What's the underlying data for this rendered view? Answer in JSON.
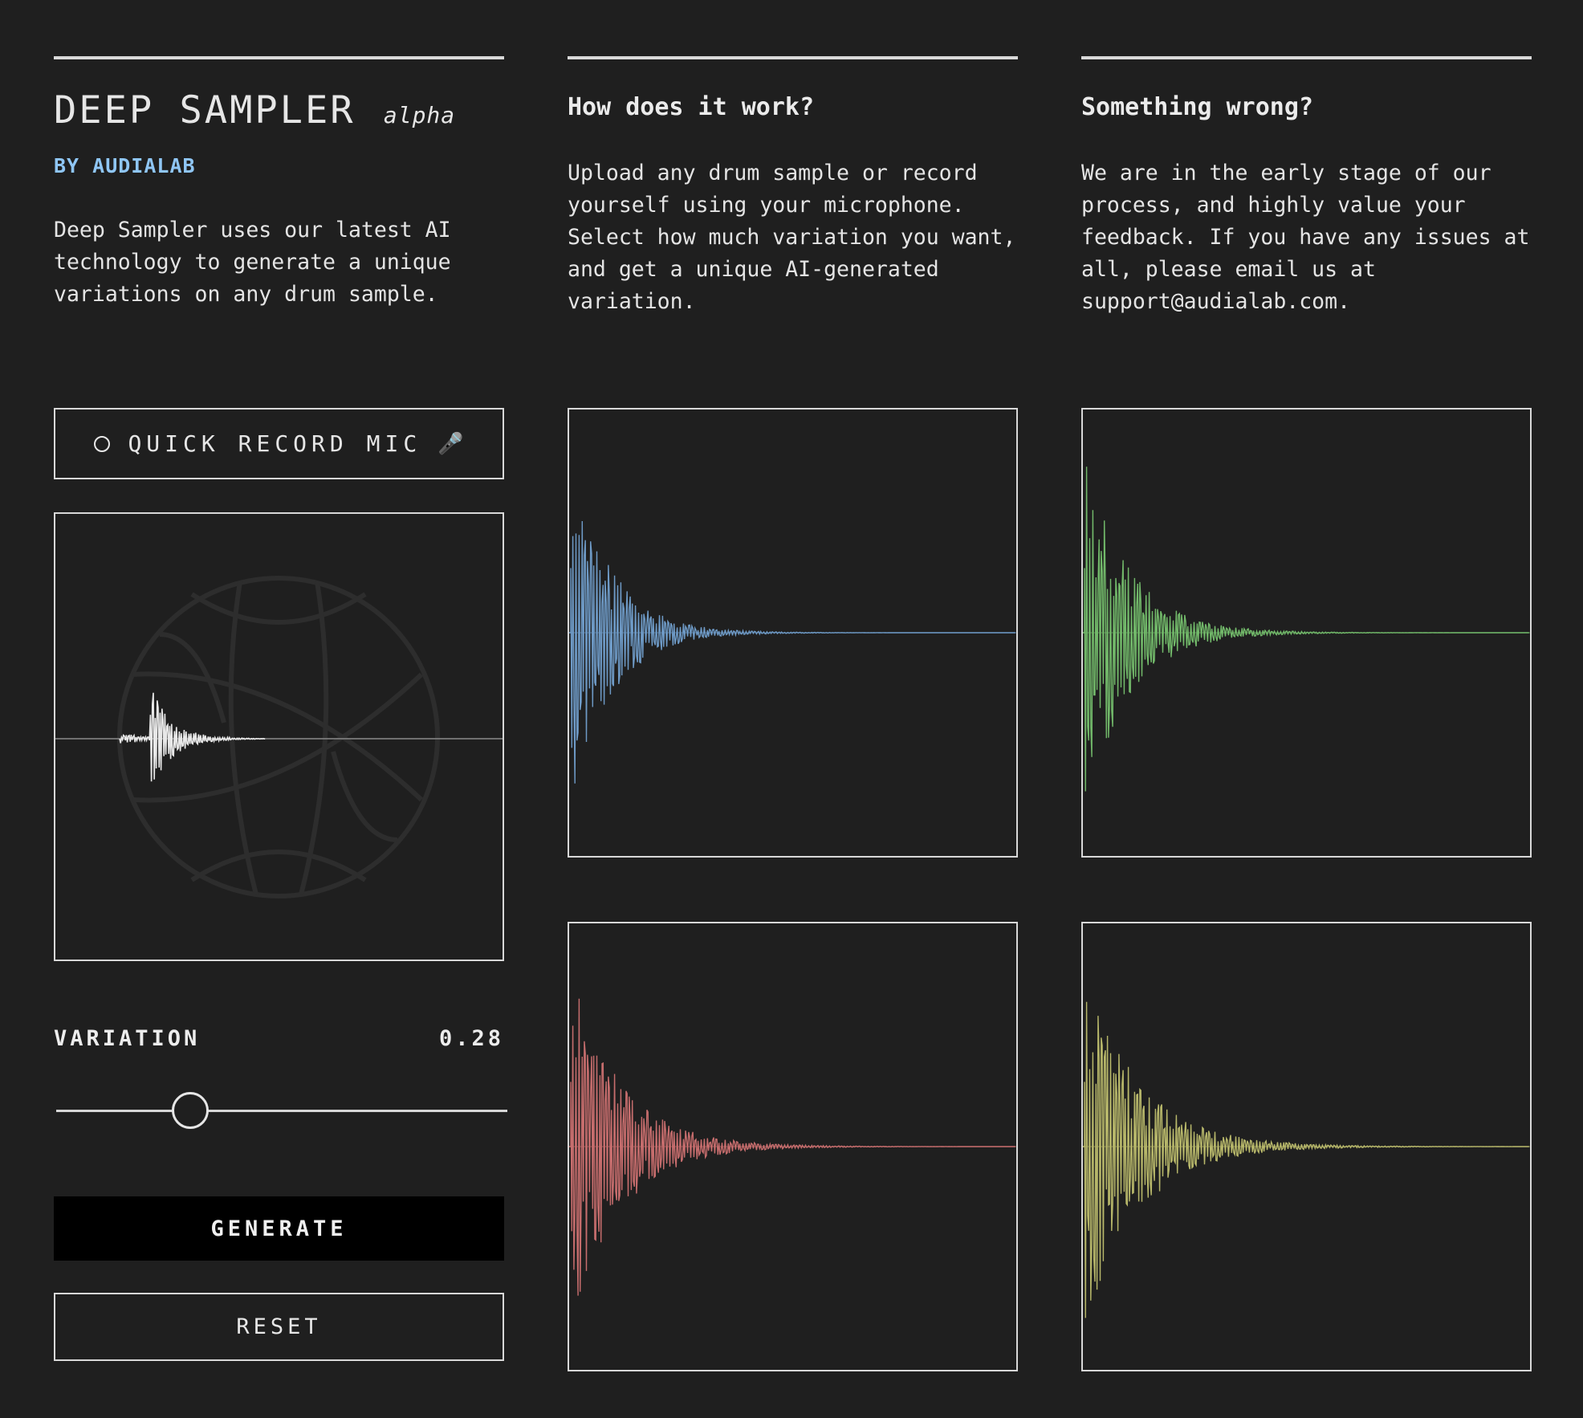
{
  "app": {
    "title": "DEEP SAMPLER",
    "title_suffix": "alpha",
    "byline": "BY AUDIALAB",
    "description": "Deep Sampler uses our latest AI technology to generate a unique variations on any drum sample."
  },
  "how_it_works": {
    "heading": "How does it work?",
    "body": "Upload any drum sample or record yourself using your microphone. Select how much variation you want, and get a unique AI-generated variation."
  },
  "something_wrong": {
    "heading": "Something wrong?",
    "body": "We are in the early stage of our process, and highly value your feedback. If you have any issues at all, please email us at support@audialab.com."
  },
  "controls": {
    "record_label": "QUICK RECORD MIC",
    "record_icon": "mic-icon",
    "variation_label": "VARIATION",
    "variation_value": "0.28",
    "variation_fraction": 0.28,
    "generate_label": "GENERATE",
    "reset_label": "RESET"
  },
  "colors": {
    "background": "#1f1f1f",
    "accent_link": "#8fc6f5",
    "input_waveform": "#e8e8e8",
    "wave_blue": "#6e9ac6",
    "wave_green": "#72b96a",
    "wave_red": "#c66d6d",
    "wave_yellow": "#b7b76a"
  },
  "variations": [
    {
      "color": "#6e9ac6"
    },
    {
      "color": "#72b96a"
    },
    {
      "color": "#c66d6d"
    },
    {
      "color": "#b7b76a"
    }
  ]
}
